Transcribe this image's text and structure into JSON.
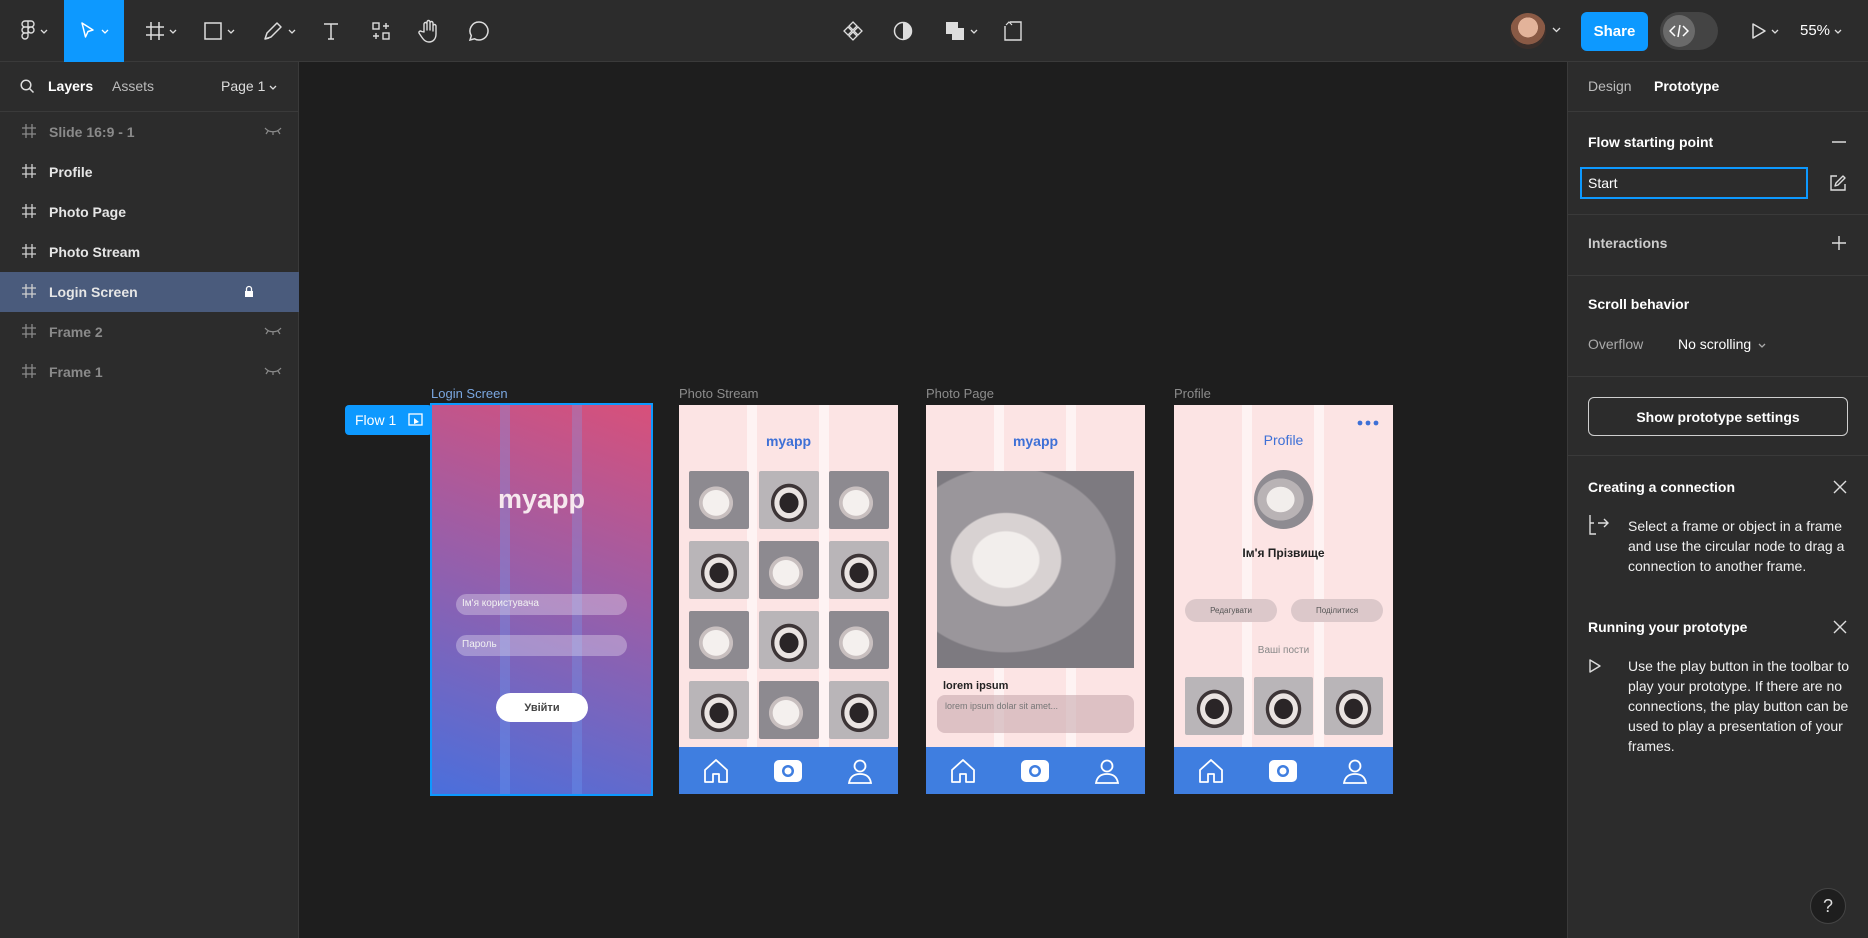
{
  "toolbar": {
    "share_label": "Share",
    "zoom": "55%"
  },
  "left_panel": {
    "tab_layers": "Layers",
    "tab_assets": "Assets",
    "page_select": "Page 1",
    "layers": [
      {
        "name": "Slide 16:9 - 1",
        "state": "hidden"
      },
      {
        "name": "Profile",
        "state": "visible"
      },
      {
        "name": "Photo Page",
        "state": "visible"
      },
      {
        "name": "Photo Stream",
        "state": "visible"
      },
      {
        "name": "Login Screen",
        "state": "selected-locked"
      },
      {
        "name": "Frame 2",
        "state": "hidden"
      },
      {
        "name": "Frame 1",
        "state": "hidden"
      }
    ]
  },
  "canvas": {
    "flow_label": "Flow 1",
    "frames": {
      "login": {
        "label": "Login Screen",
        "app_title": "myapp",
        "username_placeholder": "Ім'я користувача",
        "password_placeholder": "Пароль",
        "login_button": "Увійти"
      },
      "stream": {
        "label": "Photo Stream",
        "app_title": "myapp"
      },
      "photo": {
        "label": "Photo Page",
        "app_title": "myapp",
        "caption_title": "lorem ipsum",
        "caption_text": "lorem ipsum dolar sit amet..."
      },
      "profile": {
        "label": "Profile",
        "title": "Profile",
        "user_name": "Ім'я Прізвище",
        "edit_button": "Редагувати",
        "share_button": "Поділитися",
        "posts_label": "Ваші пости"
      }
    }
  },
  "right_panel": {
    "tab_design": "Design",
    "tab_prototype": "Prototype",
    "flow_start_title": "Flow starting point",
    "flow_start_value": "Start",
    "interactions_title": "Interactions",
    "scroll_title": "Scroll behavior",
    "overflow_label": "Overflow",
    "overflow_value": "No scrolling",
    "prototype_settings_button": "Show prototype settings",
    "connection_title": "Creating a connection",
    "connection_text": "Select a frame or object in a frame and use the circular node to drag a connection to another frame.",
    "running_title": "Running your prototype",
    "running_text": "Use the play button in the toolbar to play your prototype. If there are no connections, the play button can be used to play a presentation of your frames."
  },
  "help_label": "?"
}
